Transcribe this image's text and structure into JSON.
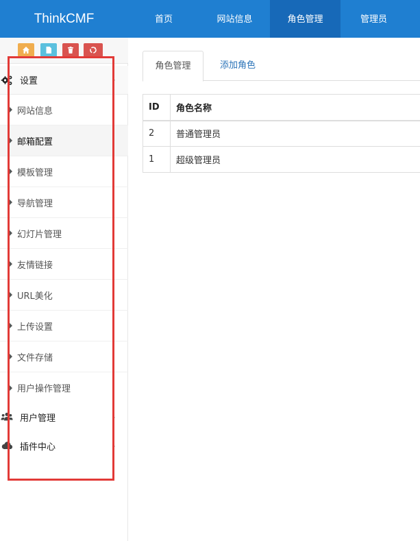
{
  "navbar": {
    "brand": "ThinkCMF",
    "items": [
      {
        "label": "首页"
      },
      {
        "label": "网站信息"
      },
      {
        "label": "角色管理",
        "active": true
      },
      {
        "label": "管理员"
      }
    ]
  },
  "sidebar": {
    "shortcut_buttons": [
      {
        "icon": "home-icon",
        "color": "#f0ad4e"
      },
      {
        "icon": "file-icon",
        "color": "#5bc0de"
      },
      {
        "icon": "trash-icon",
        "color": "#d9534f"
      },
      {
        "icon": "recycle-icon",
        "color": "#d9534f"
      }
    ],
    "settings": {
      "label": "设置",
      "icon": "gears-icon"
    },
    "settings_items": [
      {
        "label": "网站信息"
      },
      {
        "label": "邮箱配置",
        "hover": true
      },
      {
        "label": "模板管理"
      },
      {
        "label": "导航管理"
      },
      {
        "label": "幻灯片管理"
      },
      {
        "label": "友情链接"
      },
      {
        "label": "URL美化"
      },
      {
        "label": "上传设置"
      },
      {
        "label": "文件存储"
      },
      {
        "label": "用户操作管理"
      }
    ],
    "user_management": {
      "label": "用户管理",
      "icon": "users-icon"
    },
    "plugin_center": {
      "label": "插件中心",
      "icon": "cloud-icon"
    }
  },
  "content": {
    "tabs": [
      {
        "label": "角色管理",
        "active": true
      },
      {
        "label": "添加角色"
      }
    ],
    "table": {
      "headers": [
        "ID",
        "角色名称"
      ],
      "rows": [
        [
          "2",
          "普通管理员"
        ],
        [
          "1",
          "超级管理员"
        ]
      ]
    }
  },
  "colors": {
    "navbar": "#1f7fd1",
    "navbar_active": "#1769b8",
    "highlight_border": "#e23a37",
    "link": "#2a73b8"
  }
}
